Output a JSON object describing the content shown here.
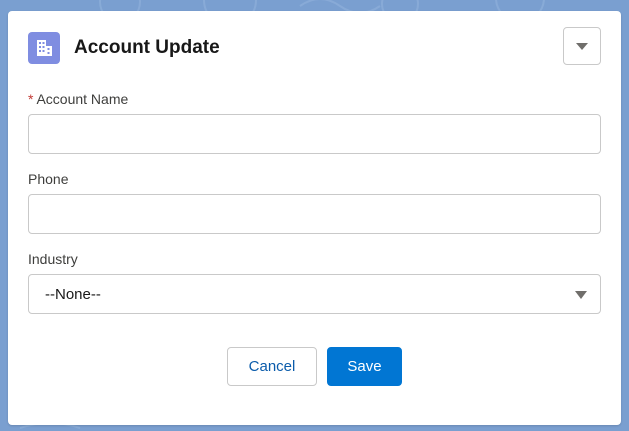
{
  "modal": {
    "title": "Account Update",
    "header_icon": "building-icon",
    "menu_icon": "chevron-down-icon"
  },
  "form": {
    "account_name": {
      "label": "Account Name",
      "required_marker": "*",
      "value": ""
    },
    "phone": {
      "label": "Phone",
      "value": ""
    },
    "industry": {
      "label": "Industry",
      "selected": "--None--",
      "icon": "caret-down-icon"
    }
  },
  "buttons": {
    "cancel_label": "Cancel",
    "save_label": "Save"
  },
  "colors": {
    "brand": "#0176d3",
    "icon_bg": "#7f8de1",
    "required": "#c23934",
    "backdrop": "#7a9fd0"
  }
}
